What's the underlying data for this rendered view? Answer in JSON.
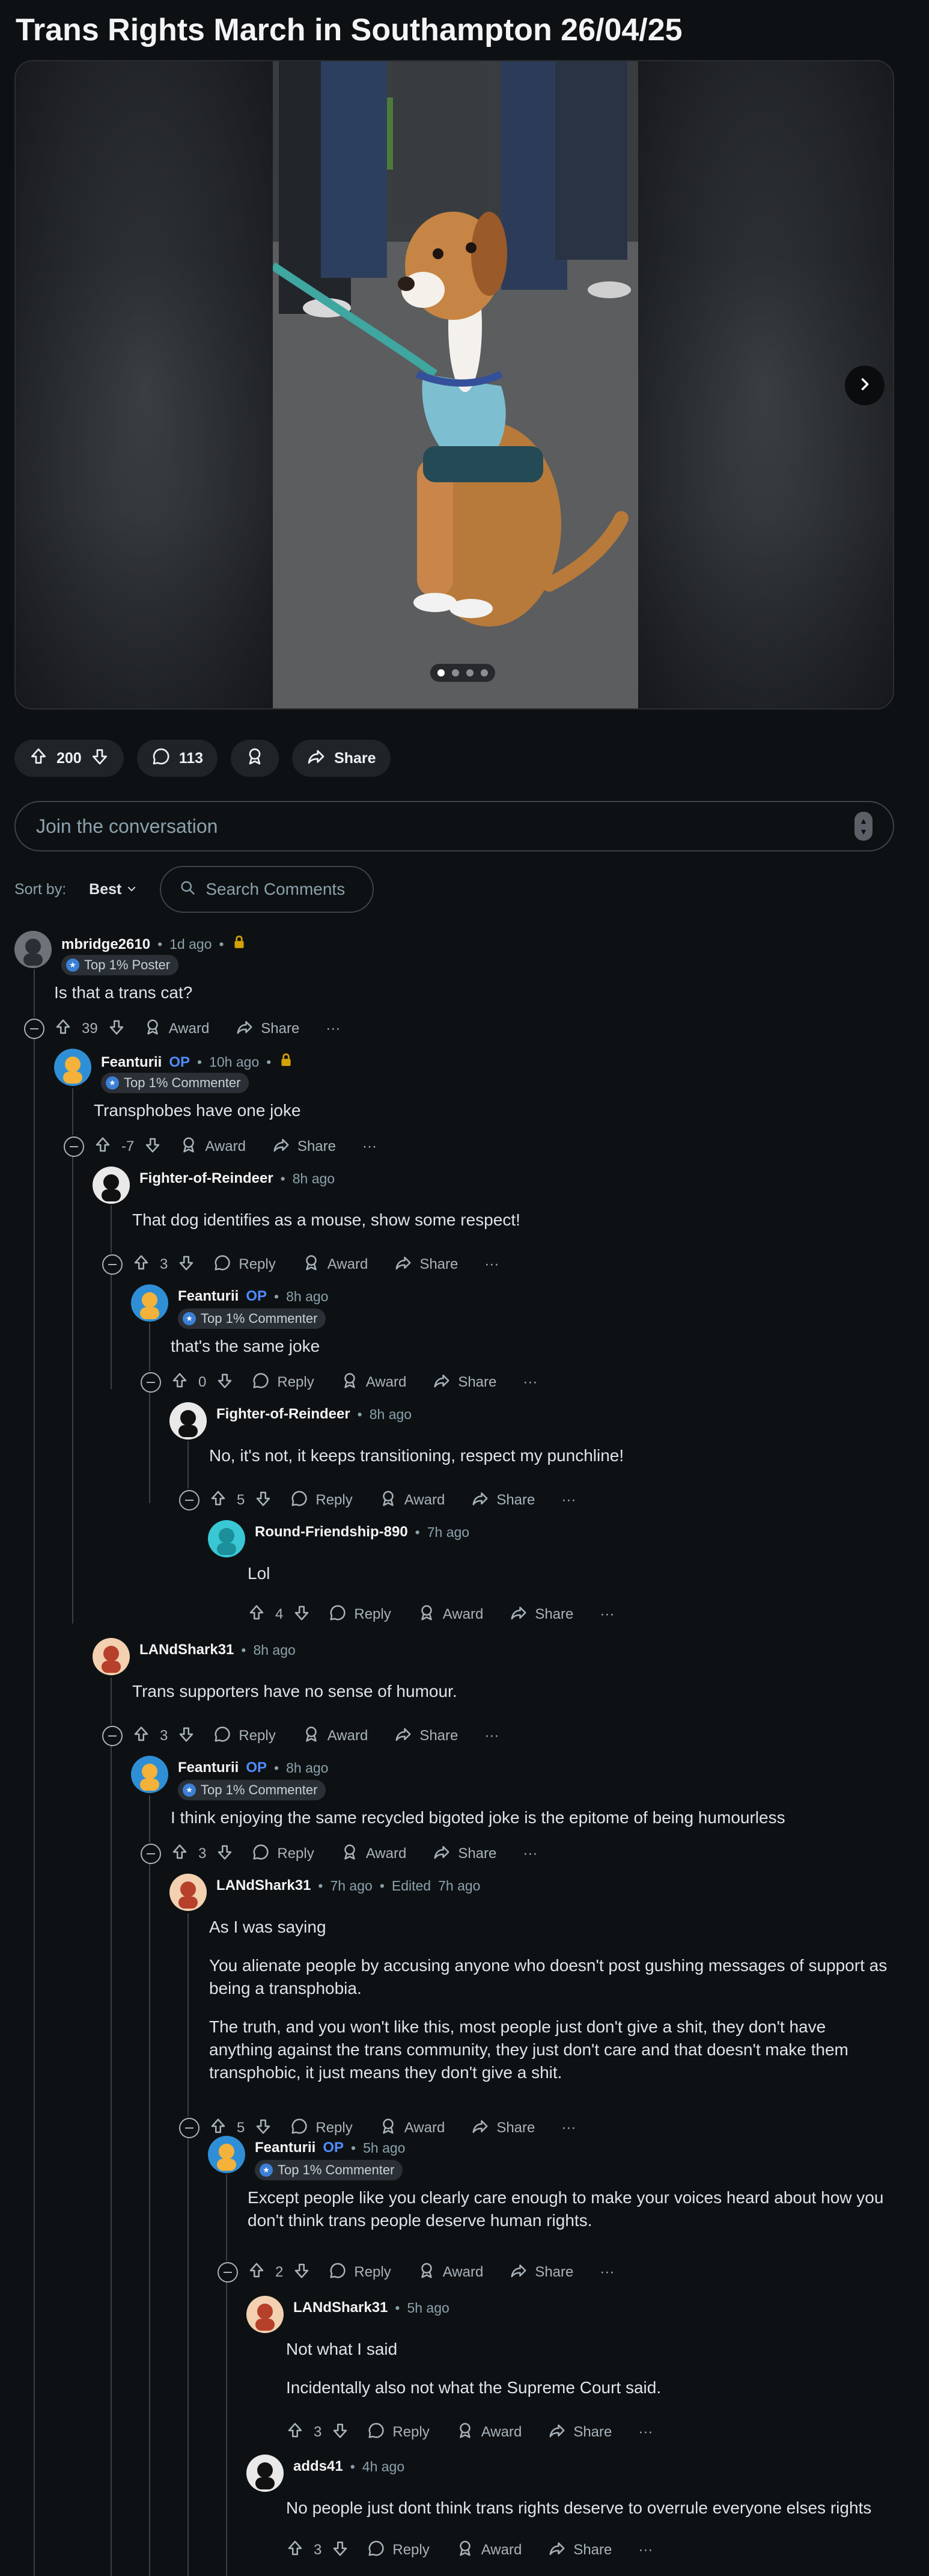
{
  "post": {
    "title": "Trans Rights March in Southampton 26/04/25",
    "vote_count": "200",
    "comment_count": "113",
    "share_label": "Share",
    "carousel": {
      "total": 4,
      "current": 1
    }
  },
  "composer": {
    "placeholder": "Join the conversation"
  },
  "sort": {
    "label": "Sort by:",
    "value": "Best",
    "search_placeholder": "Search Comments"
  },
  "labels": {
    "reply": "Reply",
    "award": "Award",
    "share": "Share",
    "op": "OP",
    "edited": "Edited"
  },
  "comments": [
    {
      "author": "mbridge2610",
      "time": "1d ago",
      "locked": true,
      "flair": "Top 1% Poster",
      "body": [
        "Is that a trans cat?"
      ],
      "votes": "39",
      "has_reply": false
    },
    {
      "author": "Feanturii",
      "op": true,
      "time": "10h ago",
      "locked": true,
      "flair": "Top 1% Commenter",
      "body": [
        "Transphobes have one joke"
      ],
      "votes": "-7",
      "has_reply": false
    },
    {
      "author": "Fighter-of-Reindeer",
      "time": "8h ago",
      "body": [
        "That dog identifies as a mouse, show some respect!"
      ],
      "votes": "3",
      "has_reply": true
    },
    {
      "author": "Feanturii",
      "op": true,
      "time": "8h ago",
      "flair": "Top 1% Commenter",
      "body": [
        "that's the same joke"
      ],
      "votes": "0",
      "has_reply": true
    },
    {
      "author": "Fighter-of-Reindeer",
      "time": "8h ago",
      "body": [
        "No, it's not, it keeps transitioning, respect my punchline!"
      ],
      "votes": "5",
      "has_reply": true
    },
    {
      "author": "Round-Friendship-890",
      "time": "7h ago",
      "body": [
        "Lol"
      ],
      "votes": "4",
      "has_reply": true
    },
    {
      "author": "LANdShark31",
      "time": "8h ago",
      "body": [
        "Trans supporters have no sense of humour."
      ],
      "votes": "3",
      "has_reply": true
    },
    {
      "author": "Feanturii",
      "op": true,
      "time": "8h ago",
      "flair": "Top 1% Commenter",
      "body": [
        "I think enjoying the same recycled bigoted joke is the epitome of being humourless"
      ],
      "votes": "3",
      "has_reply": true
    },
    {
      "author": "LANdShark31",
      "time": "7h ago",
      "edited": "7h ago",
      "body": [
        "As I was saying",
        "You alienate people by accusing anyone who doesn't post gushing messages of support as being a transphobia.",
        "The truth, and you won't like this, most people just don't give a shit, they don't have anything against the trans community, they just don't care and that doesn't make them transphobic, it just means they don't give a shit."
      ],
      "votes": "5",
      "has_reply": true
    },
    {
      "author": "Feanturii",
      "op": true,
      "time": "5h ago",
      "flair": "Top 1% Commenter",
      "body": [
        "Except people like you clearly care enough to make your voices heard about how you don't think trans people deserve human rights."
      ],
      "votes": "2",
      "has_reply": true
    },
    {
      "author": "LANdShark31",
      "time": "5h ago",
      "body": [
        "Not what I said",
        "Incidentally also not what the Supreme Court said."
      ],
      "votes": "3",
      "has_reply": true
    },
    {
      "author": "adds41",
      "time": "4h ago",
      "body": [
        "No people just dont think trans rights deserve to overrule everyone elses rights"
      ],
      "votes": "3",
      "has_reply": true
    }
  ]
}
